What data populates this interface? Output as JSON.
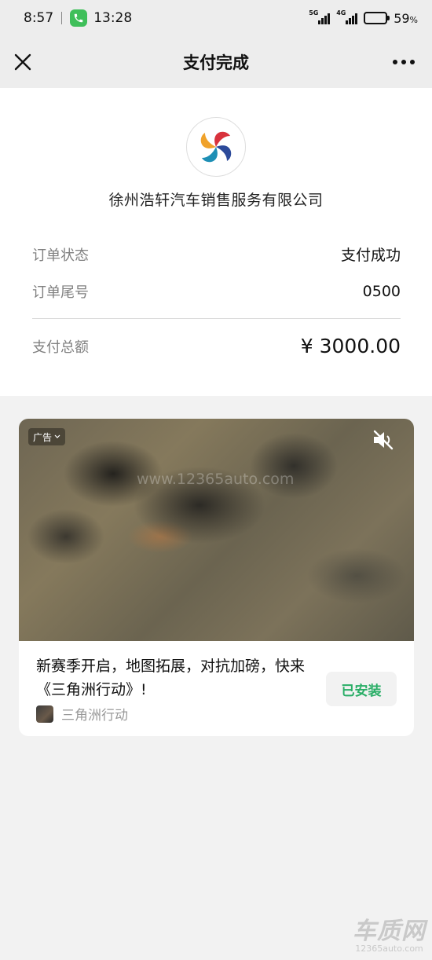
{
  "status_bar": {
    "time": "8:57",
    "call_time": "13:28",
    "network_1": "5G",
    "network_2": "4G",
    "battery": "59",
    "battery_unit": "%",
    "battery_level": 0.59
  },
  "navbar": {
    "title": "支付完成",
    "close_icon": "close-icon",
    "more_icon": "more-icon"
  },
  "merchant": {
    "name": "徐州浩轩汽车销售服务有限公司",
    "logo_icon": "pinwheel-logo"
  },
  "order": {
    "status_label": "订单状态",
    "status_value": "支付成功",
    "tail_label": "订单尾号",
    "tail_value": "0500",
    "total_label": "支付总额",
    "total_value": "¥ 3000.00"
  },
  "ad": {
    "badge": "广告",
    "video_watermark": "www.12365auto.com",
    "headline": "新赛季开启，地图拓展，对抗加磅，快来《三角洲行动》!",
    "app_name": "三角洲行动",
    "button_label": "已安装",
    "mute_icon": "speaker-muted-icon"
  },
  "watermark": {
    "brand": "车质网",
    "url": "12365auto.com"
  },
  "colors": {
    "accent_green": "#2aae67",
    "background": "#f2f2f2"
  }
}
